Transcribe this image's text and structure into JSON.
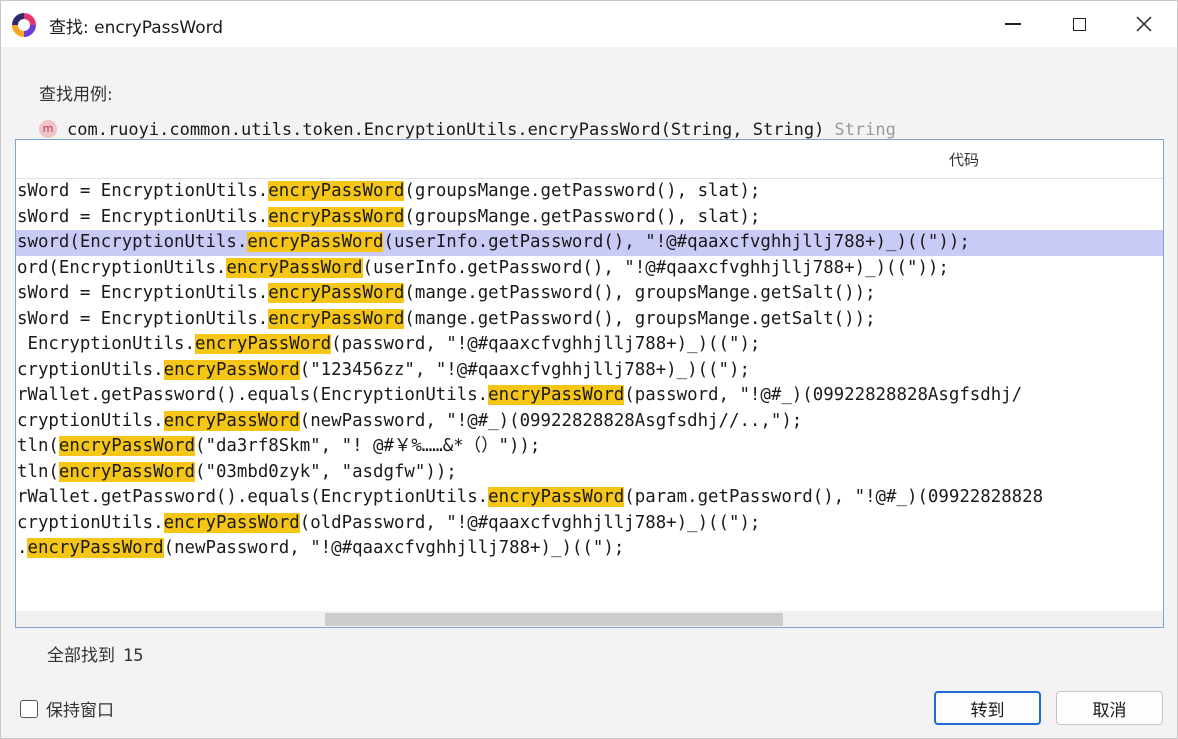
{
  "window": {
    "title": "查找: encryPassWord"
  },
  "header": {
    "usage_label": "查找用例:",
    "method_icon": "m",
    "method_signature": "com.ruoyi.common.utils.token.EncryptionUtils.encryPassWord(String, String)",
    "return_type": "String"
  },
  "table": {
    "column_header": "代码",
    "rows": [
      {
        "pre": "sWord = EncryptionUtils.",
        "hit": "encryPassWord",
        "post": "(groupsMange.getPassword(), slat);"
      },
      {
        "pre": "sWord = EncryptionUtils.",
        "hit": "encryPassWord",
        "post": "(groupsMange.getPassword(), slat);"
      },
      {
        "pre": "sword(EncryptionUtils.",
        "hit": "encryPassWord",
        "post": "(userInfo.getPassword(), \"!@#qaaxcfvghhjllj788+)_)((\"));"
      },
      {
        "pre": "ord(EncryptionUtils.",
        "hit": "encryPassWord",
        "post": "(userInfo.getPassword(), \"!@#qaaxcfvghhjllj788+)_)((\"));"
      },
      {
        "pre": "sWord = EncryptionUtils.",
        "hit": "encryPassWord",
        "post": "(mange.getPassword(), groupsMange.getSalt());"
      },
      {
        "pre": "sWord = EncryptionUtils.",
        "hit": "encryPassWord",
        "post": "(mange.getPassword(), groupsMange.getSalt());"
      },
      {
        "pre": " EncryptionUtils.",
        "hit": "encryPassWord",
        "post": "(password, \"!@#qaaxcfvghhjllj788+)_)((\");"
      },
      {
        "pre": "cryptionUtils.",
        "hit": "encryPassWord",
        "post": "(\"123456zz\", \"!@#qaaxcfvghhjllj788+)_)((\");"
      },
      {
        "pre": "rWallet.getPassword().equals(EncryptionUtils.",
        "hit": "encryPassWord",
        "post": "(password, \"!@#_)(09922828828Asgfsdhj/"
      },
      {
        "pre": "cryptionUtils.",
        "hit": "encryPassWord",
        "post": "(newPassword, \"!@#_)(09922828828Asgfsdhj//..,\");"
      },
      {
        "pre": "tln(",
        "hit": "encryPassWord",
        "post": "(\"da3rf8Skm\", \"! @#￥%……&*（）\"));"
      },
      {
        "pre": "tln(",
        "hit": "encryPassWord",
        "post": "(\"03mbd0zyk\", \"asdgfw\"));"
      },
      {
        "pre": "rWallet.getPassword().equals(EncryptionUtils.",
        "hit": "encryPassWord",
        "post": "(param.getPassword(), \"!@#_)(09922828828"
      },
      {
        "pre": "cryptionUtils.",
        "hit": "encryPassWord",
        "post": "(oldPassword, \"!@#qaaxcfvghhjllj788+)_)((\");"
      },
      {
        "pre": ".",
        "hit": "encryPassWord",
        "post": "(newPassword, \"!@#qaaxcfvghhjllj788+)_)((\");"
      }
    ],
    "selected_row": 2
  },
  "footer": {
    "found_label": "全部找到",
    "found_count": "15",
    "keep_window_label": "保持窗口",
    "goto_button": "转到",
    "cancel_button": "取消"
  },
  "colors": {
    "highlight": "#f5c518",
    "selection": "#c9cbf6",
    "focus_border": "#1f6bd0"
  }
}
